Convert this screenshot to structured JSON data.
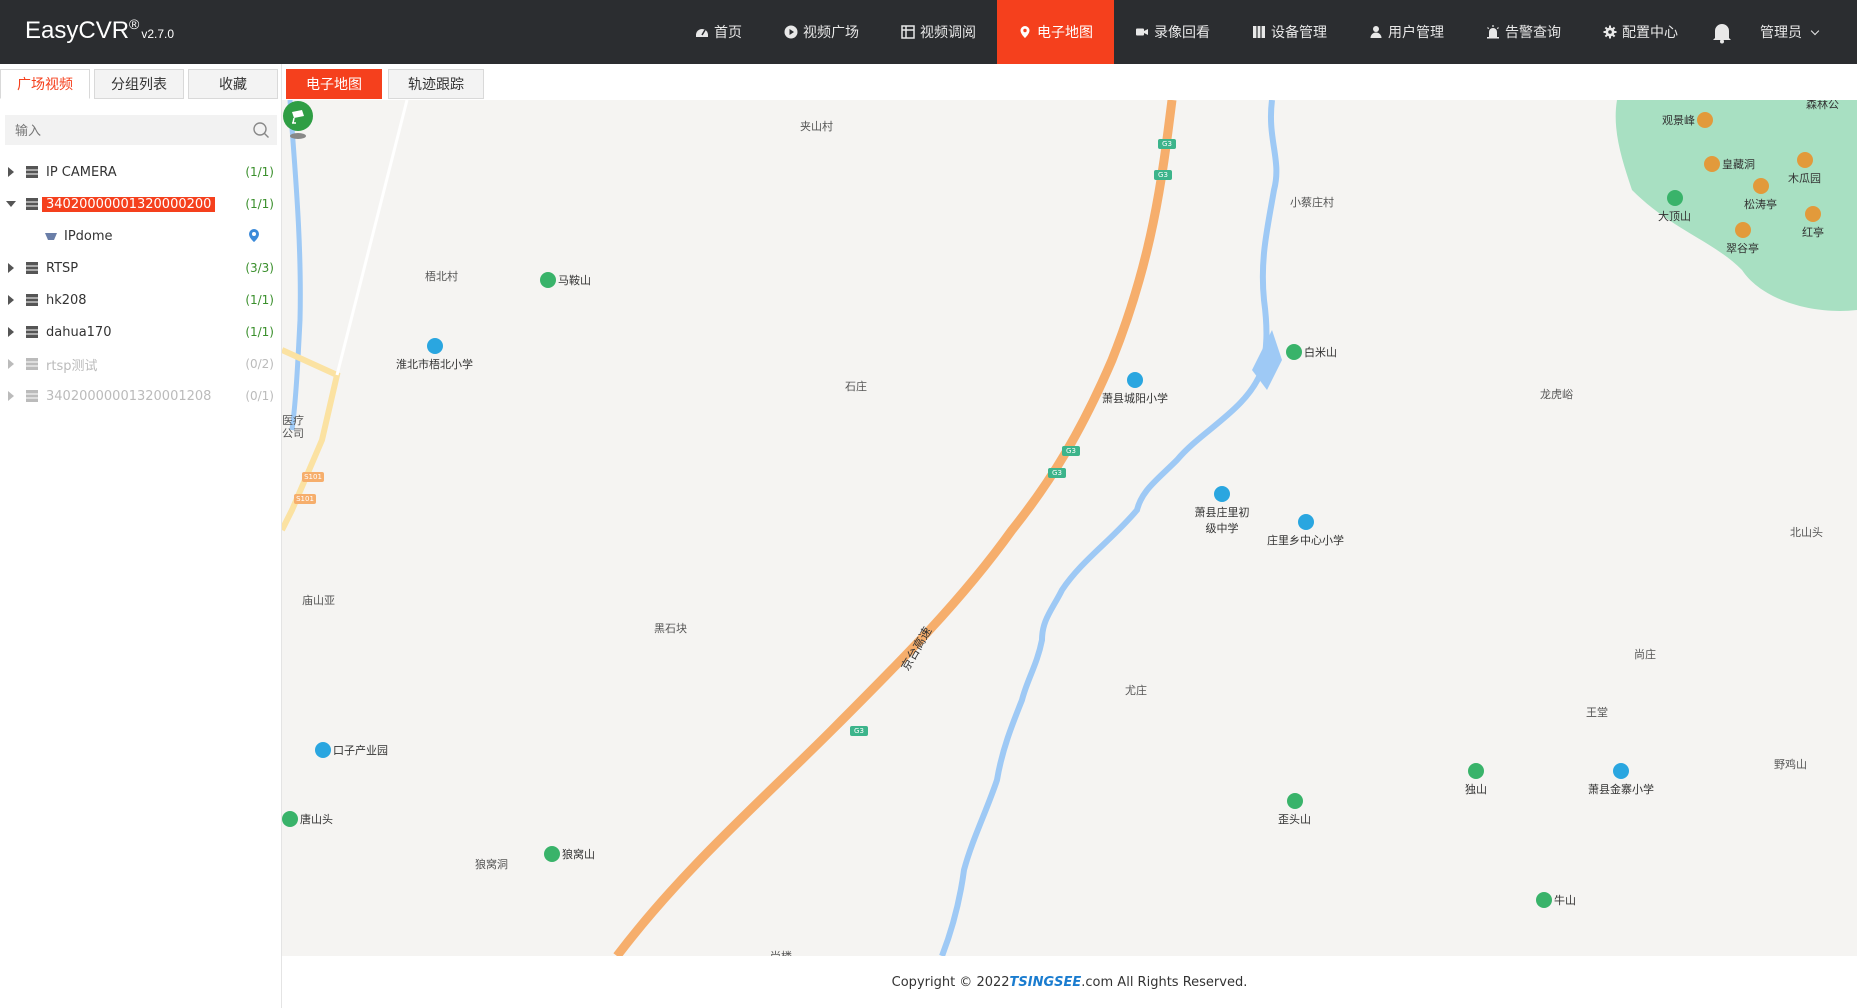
{
  "app": {
    "title": "EasyCVR",
    "reg": "®",
    "version": "v2.7.0"
  },
  "nav": {
    "items": [
      {
        "label": "首页",
        "icon": "dashboard-icon"
      },
      {
        "label": "视频广场",
        "icon": "play-icon"
      },
      {
        "label": "视频调阅",
        "icon": "grid-icon"
      },
      {
        "label": "电子地图",
        "icon": "map-pin-icon",
        "active": true
      },
      {
        "label": "录像回看",
        "icon": "video-camera-icon"
      },
      {
        "label": "设备管理",
        "icon": "device-icon"
      },
      {
        "label": "用户管理",
        "icon": "user-icon"
      },
      {
        "label": "告警查询",
        "icon": "alarm-icon"
      },
      {
        "label": "配置中心",
        "icon": "gear-icon"
      }
    ],
    "user": "管理员"
  },
  "left_tabs": [
    "广场视频",
    "分组列表",
    "收藏"
  ],
  "search": {
    "placeholder": "输入",
    "value": ""
  },
  "tree": {
    "nodes": [
      {
        "label": "IP CAMERA",
        "count": "(1/1)"
      },
      {
        "label": "34020000001320000200",
        "count": "(1/1)"
      },
      {
        "label": "IPdome"
      },
      {
        "label": "RTSP",
        "count": "(3/3)"
      },
      {
        "label": "hk208",
        "count": "(1/1)"
      },
      {
        "label": "dahua170",
        "count": "(1/1)"
      },
      {
        "label": "rtsp测试",
        "count": "(0/2)"
      },
      {
        "label": "34020000001320001208",
        "count": "(0/1)"
      }
    ]
  },
  "map_tabs": [
    "电子地图",
    "轨迹跟踪"
  ],
  "map": {
    "places": [
      "夹山村",
      "小蔡庄村",
      "梧北村",
      "石庄",
      "龙虎峪",
      "医疗公司",
      "庙山亚",
      "黑石块",
      "北山头",
      "尚庄",
      "王堂",
      "尤庄",
      "野鸡山",
      "狼窝洞",
      "尚楼"
    ],
    "pois": [
      "马鞍山",
      "淮北市梧北小学",
      "萧县城阳小学",
      "白米山",
      "萧县庄里初级中学",
      "庄里乡中心小学",
      "口子产业园",
      "唐山头",
      "狼窝山",
      "歪头山",
      "独山",
      "萧县金寨小学",
      "牛山",
      "观景峰",
      "皇藏洞",
      "木瓜园",
      "松涛亭",
      "大顶山",
      "红亭",
      "翠谷亭",
      "森林公"
    ],
    "road_name": "京台高速",
    "shields": [
      "G3",
      "S101"
    ]
  },
  "footer": {
    "prefix": "Copyright © 2022 ",
    "brand": "TSINGSEE",
    "suffix": ".com All Rights Reserved."
  }
}
